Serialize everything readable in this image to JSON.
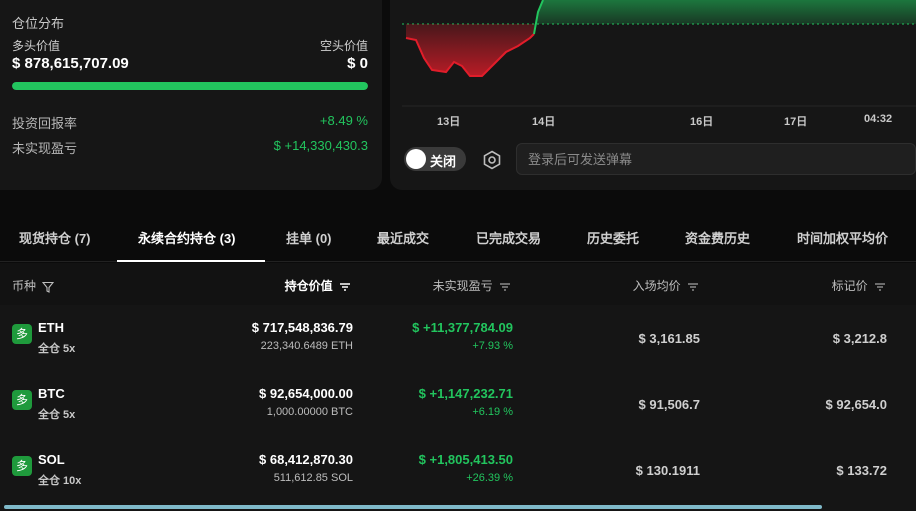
{
  "position_card": {
    "title": "仓位分布",
    "long_label": "多头价值",
    "short_label": "空头价值",
    "long_value": "$ 878,615,707.09",
    "short_value": "$ 0",
    "long_ratio": 1.0,
    "roi_label": "投资回报率",
    "roi_value": "+8.49 %",
    "upnl_label": "未实现盈亏",
    "upnl_value": "$ +14,330,430.3"
  },
  "chart": {
    "x_ticks": [
      "13日",
      "14日",
      "16日",
      "17日",
      "04:32"
    ],
    "colors": {
      "up": "#22c55e",
      "down": "#e11d2a"
    }
  },
  "danmu": {
    "toggle_label": "关闭",
    "placeholder": "登录后可发送弹幕"
  },
  "tabs": [
    {
      "label": "现货持仓 (7)",
      "active": false
    },
    {
      "label": "永续合约持仓 (3)",
      "active": true
    },
    {
      "label": "挂单 (0)",
      "active": false
    },
    {
      "label": "最近成交",
      "active": false
    },
    {
      "label": "已完成交易",
      "active": false
    },
    {
      "label": "历史委托",
      "active": false
    },
    {
      "label": "资金费历史",
      "active": false
    },
    {
      "label": "时间加权平均价",
      "active": false
    }
  ],
  "table": {
    "headers": {
      "coin": "币种",
      "position_value": "持仓价值",
      "unrealized_pnl": "未实现盈亏",
      "entry_price": "入场均价",
      "mark_price": "标记价"
    },
    "rows": [
      {
        "badge": "多",
        "symbol": "ETH",
        "mode": "全仓 5x",
        "position_value": "$ 717,548,836.79",
        "quantity": "223,340.6489 ETH",
        "pnl": "$ +11,377,784.09",
        "pnl_pct": "+7.93 %",
        "entry": "$ 3,161.85",
        "mark": "$ 3,212.8"
      },
      {
        "badge": "多",
        "symbol": "BTC",
        "mode": "全仓 5x",
        "position_value": "$ 92,654,000.00",
        "quantity": "1,000.00000 BTC",
        "pnl": "$ +1,147,232.71",
        "pnl_pct": "+6.19 %",
        "entry": "$ 91,506.7",
        "mark": "$ 92,654.0"
      },
      {
        "badge": "多",
        "symbol": "SOL",
        "mode": "全仓 10x",
        "position_value": "$ 68,412,870.30",
        "quantity": "511,612.85 SOL",
        "pnl": "$ +1,805,413.50",
        "pnl_pct": "+26.39 %",
        "entry": "$ 130.1911",
        "mark": "$ 133.72"
      }
    ]
  }
}
